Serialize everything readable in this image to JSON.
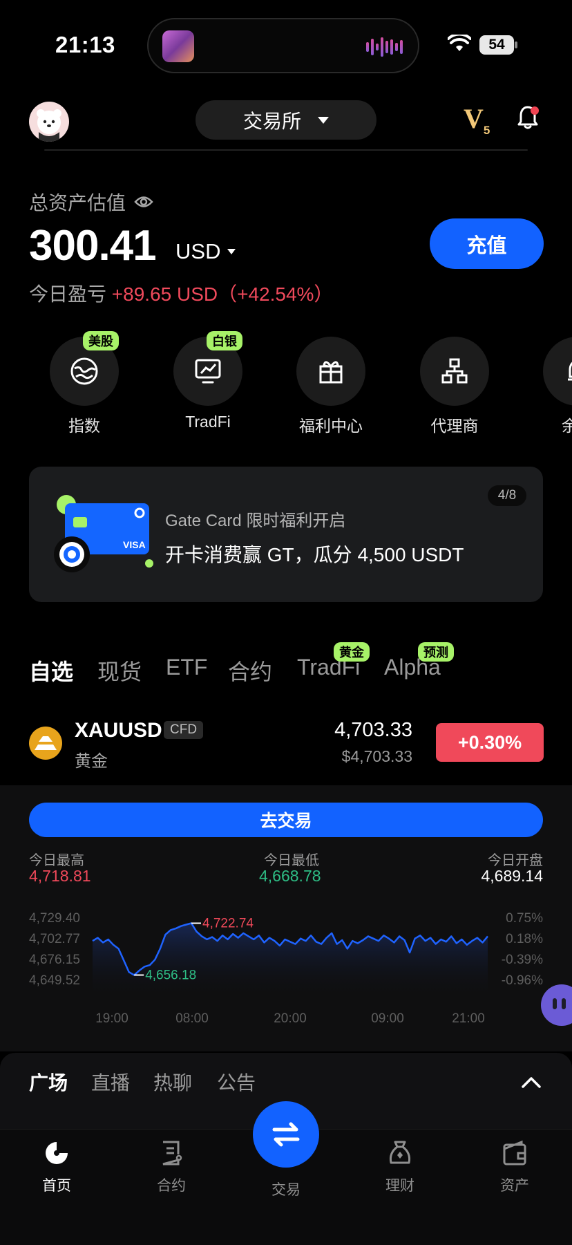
{
  "status_bar": {
    "time": "21:13",
    "battery": "54"
  },
  "header": {
    "exchange_label": "交易所",
    "vip_level": "V",
    "vip_sub": "5"
  },
  "assets": {
    "label": "总资产估值",
    "value": "300.41",
    "currency": "USD",
    "pnl_label": "今日盈亏",
    "pnl_value": "+89.65 USD（+42.54%）",
    "deposit_label": "充值"
  },
  "quick_entries": [
    {
      "label": "指数",
      "tag": "美股",
      "icon": "globe-icon"
    },
    {
      "label": "TradFi",
      "tag": "白银",
      "icon": "chart-monitor-icon"
    },
    {
      "label": "福利中心",
      "tag": "",
      "icon": "gift-icon"
    },
    {
      "label": "代理商",
      "tag": "",
      "icon": "org-chart-icon"
    },
    {
      "label": "余币",
      "tag": "",
      "icon": "bell-icon"
    }
  ],
  "banner": {
    "pager": "4/8",
    "subtitle": "Gate Card 限时福利开启",
    "title": "开卡消费赢 GT，瓜分 4,500 USDT",
    "card_brand": "VISA"
  },
  "market_tabs": [
    {
      "label": "自选",
      "tag": ""
    },
    {
      "label": "现货",
      "tag": ""
    },
    {
      "label": "ETF",
      "tag": ""
    },
    {
      "label": "合约",
      "tag": ""
    },
    {
      "label": "TradFi",
      "tag": "黄金"
    },
    {
      "label": "Alpha",
      "tag": "预测"
    }
  ],
  "asset_row": {
    "symbol": "XAUUSD",
    "badge": "CFD",
    "name": "黄金",
    "price": "4,703.33",
    "price_usd": "$4,703.33",
    "change": "+0.30%"
  },
  "detail": {
    "trade_label": "去交易",
    "high_label": "今日最高",
    "high_value": "4,718.81",
    "low_label": "今日最低",
    "low_value": "4,668.78",
    "open_label": "今日开盘",
    "open_value": "4,689.14"
  },
  "chart_data": {
    "type": "line",
    "x_ticks": [
      "19:00",
      "08:00",
      "20:00",
      "09:00",
      "21:00"
    ],
    "y_ticks_left": [
      "4,729.40",
      "4,702.77",
      "4,676.15",
      "4,649.52"
    ],
    "y_ticks_right": [
      "0.75%",
      "0.18%",
      "-0.39%",
      "-0.96%"
    ],
    "ylim": [
      4649.52,
      4729.4
    ],
    "max_label": "4,722.74",
    "min_label": "4,656.18",
    "max_value": 4722.74,
    "min_value": 4656.18,
    "values": [
      4700,
      4704,
      4698,
      4702,
      4695,
      4690,
      4675,
      4660,
      4656.18,
      4662,
      4667,
      4669,
      4676,
      4690,
      4708,
      4714,
      4716,
      4719,
      4721,
      4722.74,
      4712,
      4706,
      4702,
      4705,
      4700,
      4707,
      4702,
      4709,
      4704,
      4710,
      4706,
      4702,
      4707,
      4698,
      4704,
      4700,
      4694,
      4702,
      4699,
      4696,
      4703,
      4700,
      4707,
      4699,
      4696,
      4704,
      4710,
      4696,
      4701,
      4690,
      4700,
      4697,
      4701,
      4706,
      4703,
      4700,
      4707,
      4703,
      4698,
      4706,
      4701,
      4685,
      4703,
      4707,
      4700,
      4704,
      4696,
      4702,
      4699,
      4706,
      4697,
      4702,
      4695,
      4700,
      4704,
      4698,
      4706
    ],
    "colors": {
      "line": "#1f63ff",
      "max": "#f0495a",
      "min": "#2ebd85"
    }
  },
  "social_tabs": [
    "广场",
    "直播",
    "热聊",
    "公告"
  ],
  "bottom_nav": [
    {
      "label": "首页",
      "icon": "home-icon"
    },
    {
      "label": "合约",
      "icon": "contract-icon"
    },
    {
      "label": "交易",
      "icon": "swap-icon"
    },
    {
      "label": "理财",
      "icon": "finance-icon"
    },
    {
      "label": "资产",
      "icon": "wallet-icon"
    }
  ],
  "colors": {
    "accent": "#1262ff",
    "up": "#f0495a",
    "down": "#2ebd85",
    "tag": "#a7f268"
  }
}
